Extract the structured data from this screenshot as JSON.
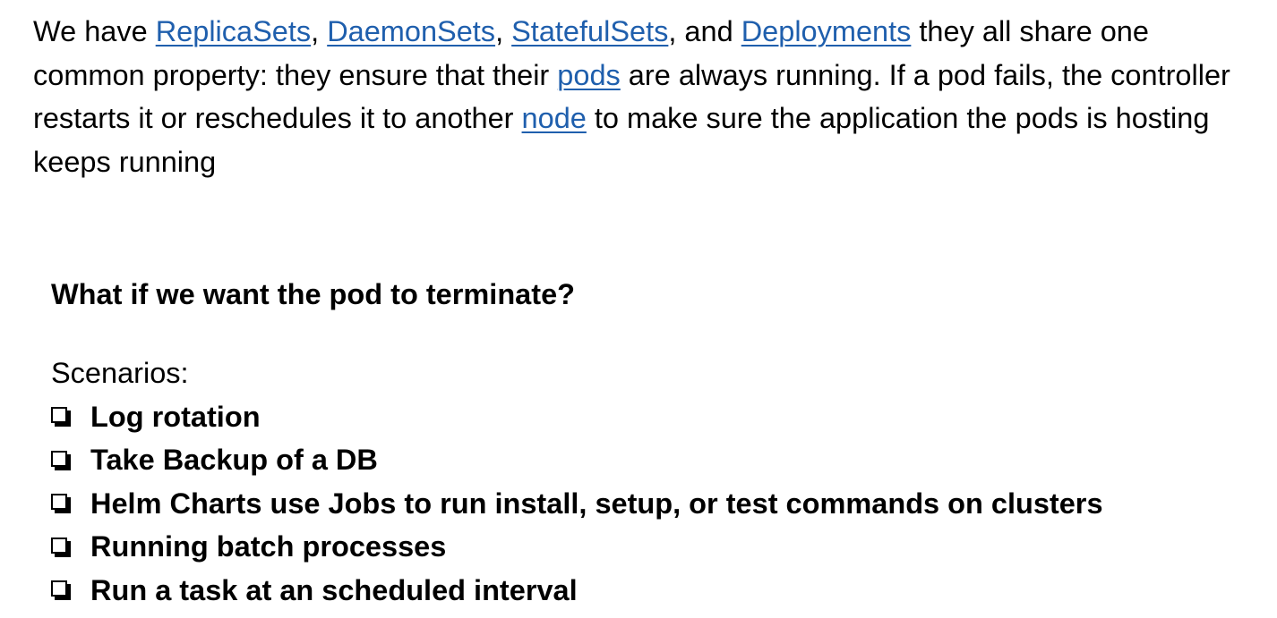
{
  "intro": {
    "t1": "We have ",
    "link_replicasets": "ReplicaSets",
    "t2": ", ",
    "link_daemonsets": "DaemonSets",
    "t3": ", ",
    "link_statefulsets": "StatefulSets",
    "t4": ", and ",
    "link_deployments": "Deployments",
    "t5": " they all share one common property: they ensure that their ",
    "link_pods": "pods",
    "t6": " are always running. If a pod fails, the controller restarts it or reschedules it to another ",
    "link_node": "node",
    "t7": " to make sure the application the pods is hosting keeps running"
  },
  "link_color": "#1f5fad",
  "question": "What if we want the pod to terminate?",
  "scenarios_label": "Scenarios:",
  "scenarios": [
    "Log rotation",
    "Take Backup of a DB",
    "Helm Charts use Jobs to run install, setup, or test commands on clusters",
    "Running batch processes",
    "Run a task at an scheduled interval"
  ],
  "checkbox_icon": "checkbox-icon"
}
